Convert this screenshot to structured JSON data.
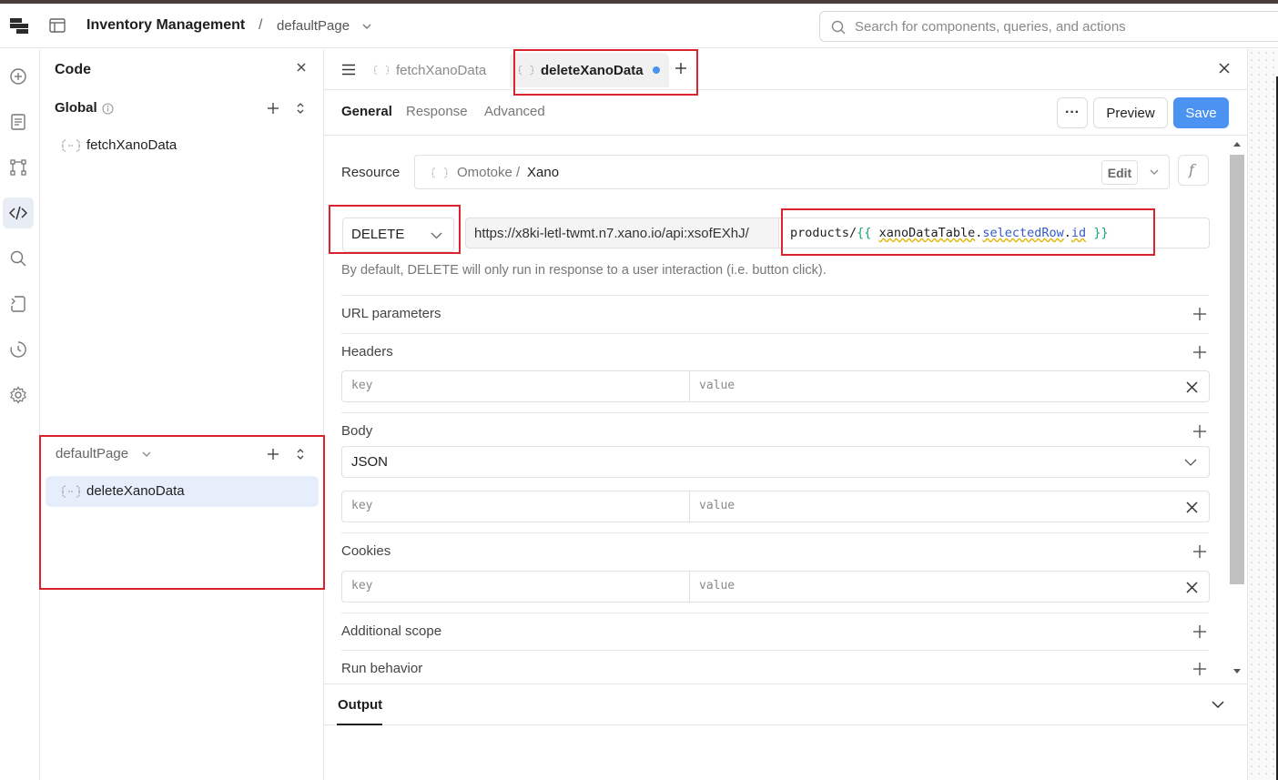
{
  "header": {
    "app_title": "Inventory Management",
    "separator": "/",
    "page_name": "defaultPage",
    "search_placeholder": "Search for components, queries, and actions"
  },
  "rail": {
    "icons": [
      "add-icon",
      "pages-icon",
      "component-tree-icon",
      "code-icon",
      "search-icon",
      "state-icon",
      "debug-history-icon",
      "settings-icon"
    ],
    "active": "code-icon"
  },
  "code_panel": {
    "title": "Code",
    "global_label": "Global",
    "global_queries": [
      "fetchXanoData"
    ],
    "page_label": "defaultPage",
    "page_queries": [
      "deleteXanoData"
    ]
  },
  "editor": {
    "tabs": [
      {
        "label": "fetchXanoData",
        "active": false
      },
      {
        "label": "deleteXanoData",
        "active": true,
        "unsaved": true
      }
    ],
    "subtabs": [
      "General",
      "Response",
      "Advanced"
    ],
    "active_subtab": "General",
    "more_label": "···",
    "preview_label": "Preview",
    "save_label": "Save"
  },
  "general": {
    "resource_label": "Resource",
    "resource_org": "Omotoke",
    "resource_sep": "/",
    "resource_name": "Xano",
    "edit_label": "Edit",
    "fx_label": "f",
    "method": "DELETE",
    "base_url": "https://x8ki-letl-twmt.n7.xano.io/api:xsofEXhJ/",
    "path_prefix": "products/",
    "path_open": "{{",
    "path_var": "xanoDataTable",
    "path_dot": ".",
    "path_prop": "selectedRow",
    "path_dot2": ".",
    "path_prop2": "id",
    "path_close": "}}",
    "hint": "By default, DELETE will only run in response to a user interaction (i.e. button click).",
    "sections": {
      "url_params": "URL parameters",
      "headers": "Headers",
      "body": "Body",
      "cookies": "Cookies",
      "additional_scope": "Additional scope",
      "run_behavior": "Run behavior"
    },
    "body_type": "JSON",
    "key_placeholder": "key",
    "value_placeholder": "value"
  },
  "output": {
    "tab_label": "Output"
  },
  "colors": {
    "accent": "#4b92f2",
    "highlight": "#d9232e",
    "selected_bg": "#e6eefb"
  }
}
